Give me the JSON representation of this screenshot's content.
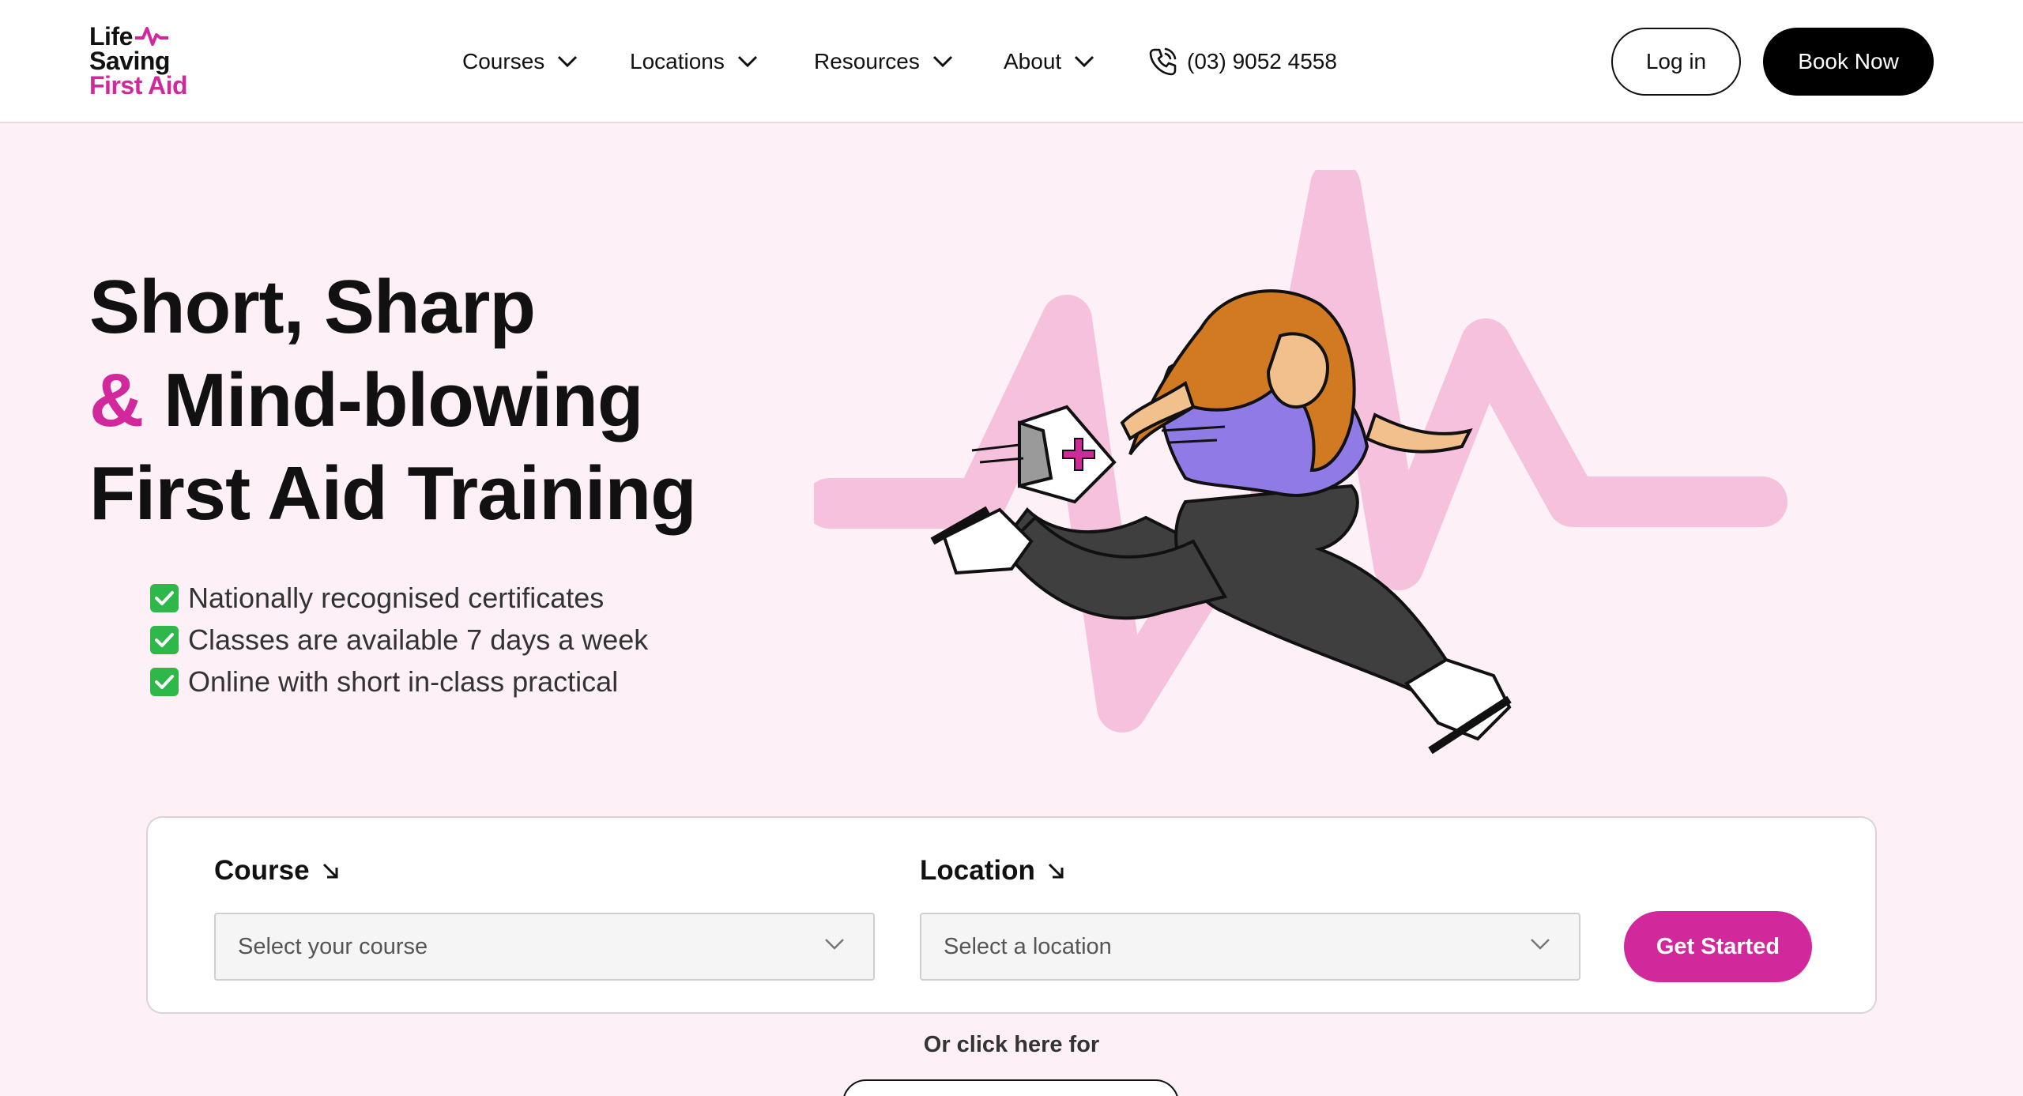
{
  "logo": {
    "line1": "Life",
    "line2": "Saving",
    "line3": "First Aid"
  },
  "nav": {
    "items": [
      {
        "label": "Courses"
      },
      {
        "label": "Locations"
      },
      {
        "label": "Resources"
      },
      {
        "label": "About"
      }
    ],
    "phone": "(03) 9052 4558",
    "login_label": "Log in",
    "book_label": "Book Now"
  },
  "hero": {
    "title_line1": "Short, Sharp",
    "title_amp": "&",
    "title_line2": " Mind-blowing",
    "title_line3": "First Aid Training",
    "features": [
      "Nationally recognised certificates",
      "Classes are available 7 days a week",
      "Online with short in-class practical"
    ]
  },
  "booking": {
    "course_label": "Course",
    "course_placeholder": "Select your course",
    "location_label": "Location",
    "location_placeholder": "Select a location",
    "submit_label": "Get Started"
  },
  "footer_hint": "Or click here for",
  "colors": {
    "brand": "#d1289c",
    "background": "#fdf0f6",
    "pulse": "#f6c1dd",
    "shirt": "#8f7ae6",
    "hair": "#d17a22"
  },
  "icons": [
    "heartbeat-icon",
    "chevron-down-icon",
    "phone-icon",
    "check-icon",
    "arrow-down-right-icon"
  ]
}
